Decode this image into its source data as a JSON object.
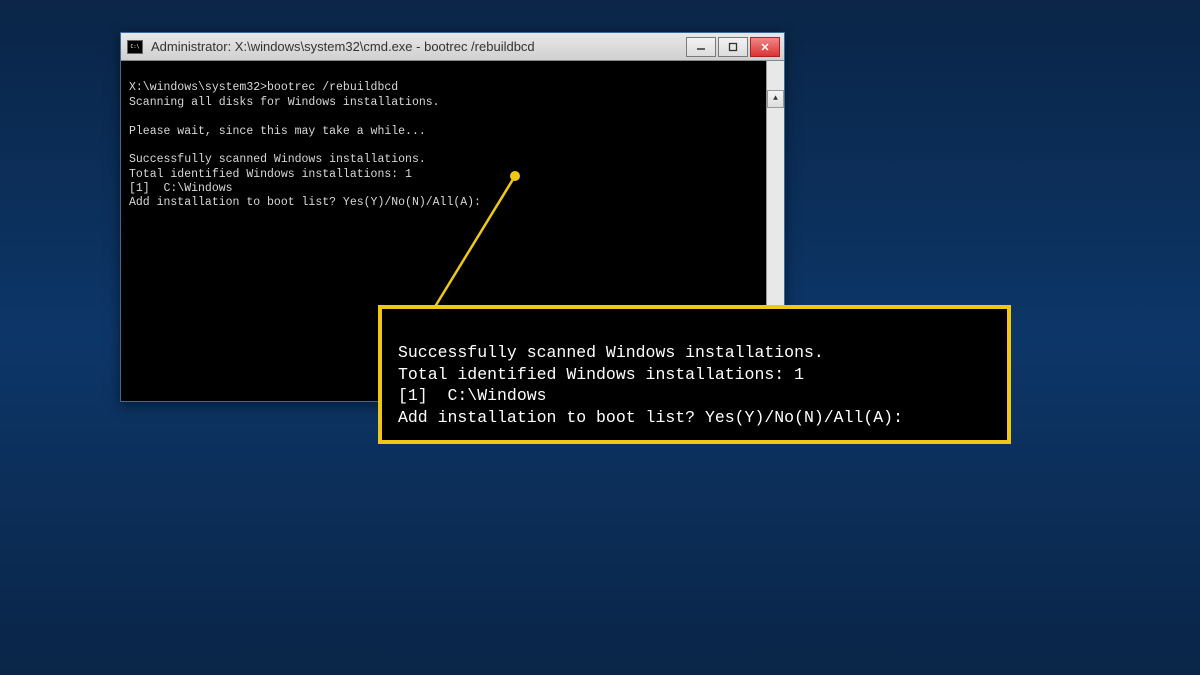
{
  "window": {
    "title": "Administrator: X:\\windows\\system32\\cmd.exe - bootrec  /rebuildbcd"
  },
  "terminal": {
    "lines": [
      "X:\\windows\\system32>bootrec /rebuildbcd",
      "Scanning all disks for Windows installations.",
      "",
      "Please wait, since this may take a while...",
      "",
      "Successfully scanned Windows installations.",
      "Total identified Windows installations: 1",
      "[1]  C:\\Windows",
      "Add installation to boot list? Yes(Y)/No(N)/All(A):"
    ]
  },
  "callout": {
    "lines": [
      "Successfully scanned Windows installations.",
      "Total identified Windows installations: 1",
      "[1]  C:\\Windows",
      "Add installation to boot list? Yes(Y)/No(N)/All(A):"
    ]
  }
}
